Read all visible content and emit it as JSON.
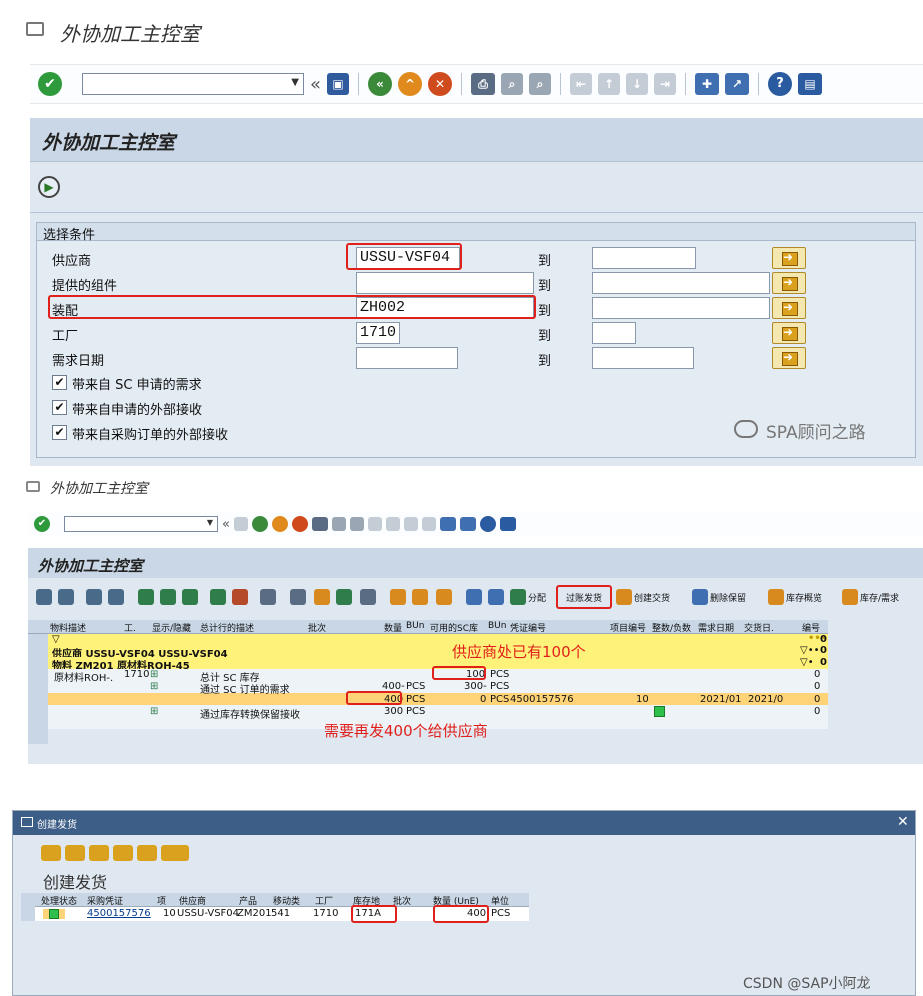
{
  "screen1": {
    "window_title": "外协加工主控室",
    "page_title": "外协加工主控室",
    "section_title": "选择条件",
    "range_to": "到",
    "fields": [
      {
        "label": "供应商",
        "value": "USSU-VSF04"
      },
      {
        "label": "提供的组件",
        "value": ""
      },
      {
        "label": "装配",
        "value": "ZH002"
      },
      {
        "label": "工厂",
        "value": "1710"
      },
      {
        "label": "需求日期",
        "value": ""
      }
    ],
    "checkboxes": [
      {
        "label": "带来自 SC 申请的需求",
        "checked": "✔"
      },
      {
        "label": "带来自申请的外部接收",
        "checked": "✔"
      },
      {
        "label": "带来自采购订单的外部接收",
        "checked": "✔"
      }
    ],
    "watermark": "SPA顾问之路"
  },
  "screen2": {
    "window_title": "外协加工主控室",
    "page_title": "外协加工主控室",
    "toolbar_labels": {
      "assign": "分配",
      "post_issue": "过账发货",
      "create_delivery": "创建交货",
      "delete_reservation": "删除保留",
      "stock_overview": "库存概览",
      "stock_requirement": "库存/需求"
    },
    "columns": [
      "物料描述",
      "工.",
      "显示/隐藏",
      "总计行的描述",
      "批次",
      "数量",
      "BUn",
      "可用的SC库",
      "BUn",
      "凭证编号",
      "项目编号",
      "整数/负数",
      "需求日期",
      "交货日.",
      "编号"
    ],
    "vendor_row": "供应商 USSU-VSF04 USSU-VSF04",
    "material_row": "物料 ZM201 原材料ROH-45",
    "rows": [
      {
        "material": "原材料ROH-.",
        "plant": "1710",
        "desc": "总计 SC 库存",
        "qty": "",
        "bun": "",
        "avail": "100",
        "bun2": "PCS",
        "doc": "",
        "item": "",
        "req_date": "",
        "deliv_date": "",
        "num": "0"
      },
      {
        "material": "",
        "plant": "",
        "desc": "通过 SC 订单的需求",
        "qty": "400-",
        "bun": "PCS",
        "avail": "300-",
        "bun2": "PCS",
        "doc": "",
        "item": "",
        "req_date": "",
        "deliv_date": "",
        "num": "0"
      },
      {
        "material": "",
        "plant": "",
        "desc": "",
        "qty": "400",
        "bun": "PCS",
        "avail": "0",
        "bun2": "PCS",
        "doc": "4500157576",
        "item": "10",
        "req_date": "2021/01",
        "deliv_date": "2021/0",
        "num": "0"
      },
      {
        "material": "",
        "plant": "",
        "desc": "通过库存转换保留接收",
        "qty": "300",
        "bun": "PCS",
        "avail": "",
        "bun2": "",
        "doc": "",
        "item": "",
        "req_date": "",
        "deliv_date": "",
        "num": "0"
      }
    ],
    "summary_nums": [
      "0",
      "0",
      "0"
    ],
    "annotation_top": "供应商处已有100个",
    "annotation_bottom": "需要再发400个给供应商"
  },
  "screen3": {
    "window_title": "创建发货",
    "page_title": "创建发货",
    "columns": [
      "处理状态",
      "采购凭证",
      "项",
      "供应商",
      "产品",
      "移动类",
      "工厂",
      "库存地",
      "批次",
      "数量 (UnE)",
      "单位"
    ],
    "row": {
      "doc": "4500157576",
      "item": "10",
      "vendor": "USSU-VSF04",
      "product": "ZM201",
      "mvt": "541",
      "plant": "1710",
      "sloc": "171A",
      "batch": "",
      "qty": "400",
      "unit": "PCS"
    },
    "credit": "CSDN @SAP小阿龙"
  },
  "colors": {
    "sap_blue": "#dfe8f1",
    "header_bg": "#c8d6e5",
    "yellow_row": "#fff27a",
    "orange_row": "#ffd478",
    "red": "#e0211b"
  },
  "icons": [
    "check-icon",
    "save-icon",
    "back-icon",
    "exit-icon",
    "cancel-icon",
    "print-icon",
    "find-icon",
    "help-icon",
    "execute-icon",
    "filter-icon",
    "drag-icon"
  ]
}
